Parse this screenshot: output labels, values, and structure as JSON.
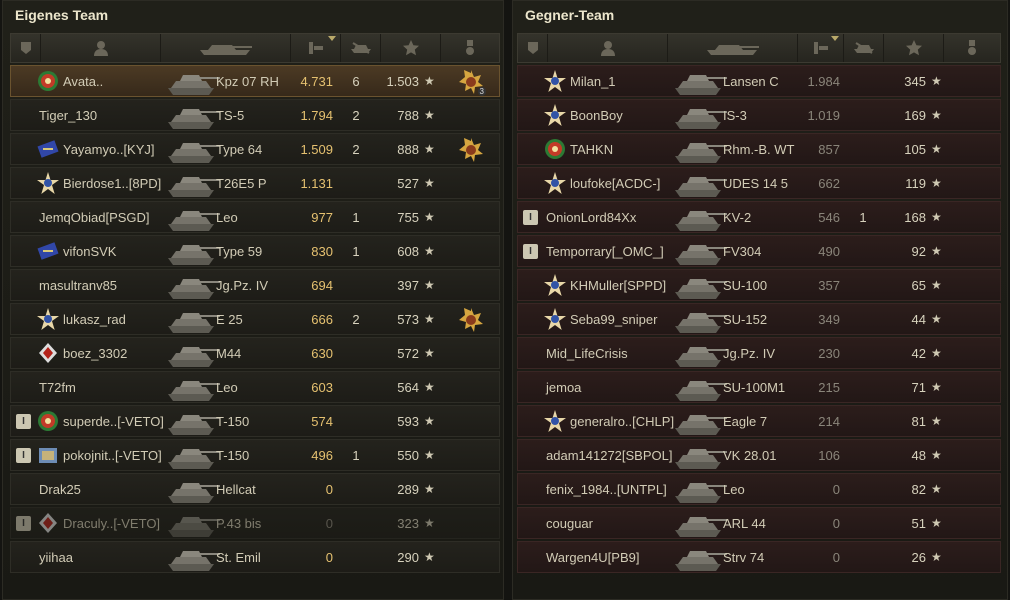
{
  "colors": {
    "ally_row": "#24231d",
    "enemy_row": "#2c1d1b",
    "player_row": "#4c3a24",
    "damage": "#e5c170"
  },
  "left_team": {
    "title": "Eigenes Team",
    "header_icons": [
      "platoon-icon",
      "player-icon",
      "vehicle-icon",
      "damage-icon",
      "frags-icon",
      "xp-icon",
      "medal-icon"
    ],
    "rows": [
      {
        "platoon": "",
        "badge": "medal-badge",
        "name": "Avata..",
        "tank": "Kpz 07 RH",
        "dmg": "4.731",
        "kills": "6",
        "xp": "1.503",
        "medal": "3",
        "player": true,
        "dead": false
      },
      {
        "platoon": "",
        "badge": "",
        "name": "Tiger_130",
        "tank": "TS-5",
        "dmg": "1.794",
        "kills": "2",
        "xp": "788",
        "medal": "",
        "player": false,
        "dead": false
      },
      {
        "platoon": "",
        "badge": "clan-badge",
        "name": "Yayamyo..[KYJ]",
        "tank": "Type 64",
        "dmg": "1.509",
        "kills": "2",
        "xp": "888",
        "medal": "1",
        "player": false,
        "dead": false
      },
      {
        "platoon": "",
        "badge": "star-badge",
        "name": "Bierdose1..[8PD]",
        "tank": "T26E5 P",
        "dmg": "1.131",
        "kills": "",
        "xp": "527",
        "medal": "",
        "player": false,
        "dead": false
      },
      {
        "platoon": "",
        "badge": "",
        "name": "JemqObiad[PSGD]",
        "tank": "Leo",
        "dmg": "977",
        "kills": "1",
        "xp": "755",
        "medal": "",
        "player": false,
        "dead": false
      },
      {
        "platoon": "",
        "badge": "clan-badge",
        "name": "vifonSVK",
        "tank": "Type 59",
        "dmg": "830",
        "kills": "1",
        "xp": "608",
        "medal": "",
        "player": false,
        "dead": false
      },
      {
        "platoon": "",
        "badge": "",
        "name": "masultranv85",
        "tank": "Jg.Pz. IV",
        "dmg": "694",
        "kills": "",
        "xp": "397",
        "medal": "",
        "player": false,
        "dead": false
      },
      {
        "platoon": "",
        "badge": "star-badge",
        "name": "lukasz_rad",
        "tank": "E 25",
        "dmg": "666",
        "kills": "2",
        "xp": "573",
        "medal": "1",
        "player": false,
        "dead": false
      },
      {
        "platoon": "",
        "badge": "diamond-badge",
        "name": "boez_3302",
        "tank": "M44",
        "dmg": "630",
        "kills": "",
        "xp": "572",
        "medal": "",
        "player": false,
        "dead": false
      },
      {
        "platoon": "",
        "badge": "",
        "name": "T72fm",
        "tank": "Leo",
        "dmg": "603",
        "kills": "",
        "xp": "564",
        "medal": "",
        "player": false,
        "dead": false
      },
      {
        "platoon": "I",
        "badge": "medal-badge",
        "name": "superde..[-VETO]",
        "tank": "T-150",
        "dmg": "574",
        "kills": "",
        "xp": "593",
        "medal": "",
        "player": false,
        "dead": false
      },
      {
        "platoon": "I",
        "badge": "crate-badge",
        "name": "pokojnit..[-VETO]",
        "tank": "T-150",
        "dmg": "496",
        "kills": "1",
        "xp": "550",
        "medal": "",
        "player": false,
        "dead": false
      },
      {
        "platoon": "",
        "badge": "",
        "name": "Drak25",
        "tank": "Hellcat",
        "dmg": "0",
        "kills": "",
        "xp": "289",
        "medal": "",
        "player": false,
        "dead": false
      },
      {
        "platoon": "I",
        "badge": "diamond-badge",
        "name": "Draculy..[-VETO]",
        "tank": "P.43 bis",
        "dmg": "0",
        "kills": "",
        "xp": "323",
        "medal": "",
        "player": false,
        "dead": true
      },
      {
        "platoon": "",
        "badge": "",
        "name": "yiihaa",
        "tank": "St. Emil",
        "dmg": "0",
        "kills": "",
        "xp": "290",
        "medal": "",
        "player": false,
        "dead": false
      }
    ]
  },
  "right_team": {
    "title": "Gegner-Team",
    "rows": [
      {
        "platoon": "",
        "badge": "star-badge",
        "name": "Milan_1",
        "tank": "Lansen C",
        "dmg": "1.984",
        "kills": "",
        "xp": "345"
      },
      {
        "platoon": "",
        "badge": "star-badge",
        "name": "BoonBoy",
        "tank": "IS-3",
        "dmg": "1.019",
        "kills": "",
        "xp": "169"
      },
      {
        "platoon": "",
        "badge": "medal-badge",
        "name": "TAHKN",
        "tank": "Rhm.-B. WT",
        "dmg": "857",
        "kills": "",
        "xp": "105"
      },
      {
        "platoon": "",
        "badge": "star-badge",
        "name": "loufoke[ACDC-]",
        "tank": "UDES 14 5",
        "dmg": "662",
        "kills": "",
        "xp": "119"
      },
      {
        "platoon": "I",
        "badge": "",
        "name": "OnionLord84Xx",
        "tank": "KV-2",
        "dmg": "546",
        "kills": "1",
        "xp": "168"
      },
      {
        "platoon": "I",
        "badge": "",
        "name": "Temporrary[_OMC_]",
        "tank": "FV304",
        "dmg": "490",
        "kills": "",
        "xp": "92"
      },
      {
        "platoon": "",
        "badge": "star-badge",
        "name": "KHMuller[SPPD]",
        "tank": "SU-100",
        "dmg": "357",
        "kills": "",
        "xp": "65"
      },
      {
        "platoon": "",
        "badge": "star-badge",
        "name": "Seba99_sniper",
        "tank": "SU-152",
        "dmg": "349",
        "kills": "",
        "xp": "44"
      },
      {
        "platoon": "",
        "badge": "",
        "name": "Mid_LifeCrisis",
        "tank": "Jg.Pz. IV",
        "dmg": "230",
        "kills": "",
        "xp": "42"
      },
      {
        "platoon": "",
        "badge": "",
        "name": "jemoa",
        "tank": "SU-100M1",
        "dmg": "215",
        "kills": "",
        "xp": "71"
      },
      {
        "platoon": "",
        "badge": "star-badge",
        "name": "generalro..[CHLP]",
        "tank": "Eagle 7",
        "dmg": "214",
        "kills": "",
        "xp": "81"
      },
      {
        "platoon": "",
        "badge": "",
        "name": "adam141272[SBPOL]",
        "tank": "VK 28.01",
        "dmg": "106",
        "kills": "",
        "xp": "48"
      },
      {
        "platoon": "",
        "badge": "",
        "name": "fenix_1984..[UNTPL]",
        "tank": "Leo",
        "dmg": "0",
        "kills": "",
        "xp": "82"
      },
      {
        "platoon": "",
        "badge": "",
        "name": "couguar",
        "tank": "ARL 44",
        "dmg": "0",
        "kills": "",
        "xp": "51"
      },
      {
        "platoon": "",
        "badge": "",
        "name": "Wargen4U[PB9]",
        "tank": "Strv 74",
        "dmg": "0",
        "kills": "",
        "xp": "26"
      }
    ]
  },
  "star_glyph": "★"
}
